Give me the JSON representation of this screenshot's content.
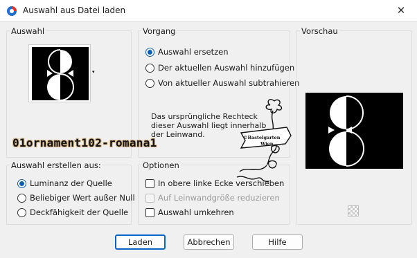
{
  "window": {
    "title": "Auswahl aus Datei laden",
    "close_glyph": "✕"
  },
  "auswahl": {
    "title": "Auswahl",
    "dropdown_glyph": "▾"
  },
  "vorgang": {
    "title": "Vorgang",
    "options": [
      {
        "label": "Auswahl ersetzen",
        "checked": true
      },
      {
        "label": "Der aktuellen Auswahl hinzufügen",
        "checked": false
      },
      {
        "label": "Von aktueller Auswahl subtrahieren",
        "checked": false
      }
    ],
    "info_text": "Das ursprüngliche Rechteck dieser Auswahl liegt innerhalb der Leinwand."
  },
  "vorschau": {
    "title": "Vorschau"
  },
  "selection_name": "01ornament102-romana1",
  "watermark": {
    "line1": "©Bastelgarten",
    "line2": "Wien"
  },
  "erstellen": {
    "title": "Auswahl erstellen aus:",
    "options": [
      {
        "label": "Luminanz der Quelle",
        "checked": true
      },
      {
        "label": "Beliebiger Wert außer Null",
        "checked": false
      },
      {
        "label": "Deckfähigkeit der Quelle",
        "checked": false
      }
    ]
  },
  "optionen": {
    "title": "Optionen",
    "options": [
      {
        "label": "In obere linke Ecke verschieben",
        "checked": false,
        "disabled": false
      },
      {
        "label": "Auf Leinwandgröße reduzieren",
        "checked": false,
        "disabled": true
      },
      {
        "label": "Auswahl umkehren",
        "checked": false,
        "disabled": false
      }
    ]
  },
  "buttons": {
    "load": "Laden",
    "cancel": "Abbrechen",
    "help": "Hilfe"
  },
  "colors": {
    "accent": "#0a5fb4",
    "window_bg": "#f0f0f0",
    "preview_bg": "#000000"
  }
}
